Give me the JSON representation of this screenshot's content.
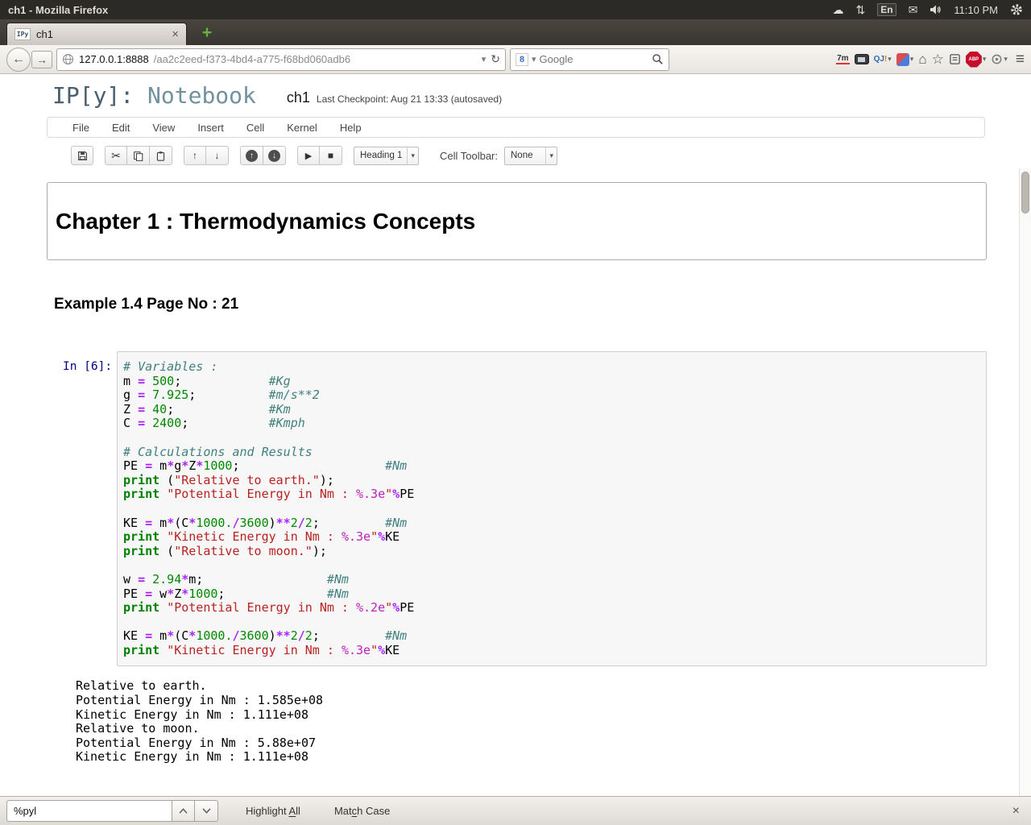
{
  "system_bar": {
    "window_title": "ch1 - Mozilla Firefox",
    "keyboard_indicator": "En",
    "clock": "11:10 PM"
  },
  "tab_bar": {
    "tab_title": "ch1",
    "tab_favicon": "IPy",
    "close_glyph": "×",
    "new_tab_glyph": "+"
  },
  "nav_bar": {
    "url_host": "127.0.0.1:8888",
    "url_path": "/aa2c2eed-f373-4bd4-a775-f68bd060adb6",
    "search_placeholder": "Google",
    "addon_7m": "7m",
    "addon_qj": "QJ",
    "addon_qj_bang": "!",
    "adblock_label": "ABP",
    "back_glyph": "←",
    "forward_glyph": "→",
    "reload_glyph": "↻",
    "dropdown_glyph": "▾",
    "home_glyph": "⌂",
    "star_glyph": "☆",
    "menu_glyph": "≡"
  },
  "notebook": {
    "logo_prefix": "IP[y]:",
    "logo_suffix": " Notebook",
    "title": "ch1",
    "checkpoint": "Last Checkpoint: Aug 21 13:33 (autosaved)",
    "menus": [
      "File",
      "Edit",
      "View",
      "Insert",
      "Cell",
      "Kernel",
      "Help"
    ],
    "toolbar": {
      "cell_type_value": "Heading 1",
      "cell_toolbar_label": "Cell Toolbar:",
      "cell_toolbar_value": "None",
      "cut_glyph": "✂",
      "up_glyph": "↑",
      "down_glyph": "↓",
      "run_glyph": "▶",
      "stop_glyph": "■"
    }
  },
  "cells": {
    "heading1": "Chapter 1 : Thermodynamics Concepts",
    "heading3": "Example 1.4 Page No : 21",
    "code_prompt": "In [6]:",
    "code_lines": [
      [
        {
          "t": "c",
          "s": "# Variables :"
        }
      ],
      [
        {
          "t": "p",
          "s": "m "
        },
        {
          "t": "o",
          "s": "="
        },
        {
          "t": "p",
          "s": " "
        },
        {
          "t": "n",
          "s": "500"
        },
        {
          "t": "p",
          "s": ";            "
        },
        {
          "t": "c",
          "s": "#Kg"
        }
      ],
      [
        {
          "t": "p",
          "s": "g "
        },
        {
          "t": "o",
          "s": "="
        },
        {
          "t": "p",
          "s": " "
        },
        {
          "t": "n",
          "s": "7.925"
        },
        {
          "t": "p",
          "s": ";          "
        },
        {
          "t": "c",
          "s": "#m/s**2"
        }
      ],
      [
        {
          "t": "p",
          "s": "Z "
        },
        {
          "t": "o",
          "s": "="
        },
        {
          "t": "p",
          "s": " "
        },
        {
          "t": "n",
          "s": "40"
        },
        {
          "t": "p",
          "s": ";             "
        },
        {
          "t": "c",
          "s": "#Km"
        }
      ],
      [
        {
          "t": "p",
          "s": "C "
        },
        {
          "t": "o",
          "s": "="
        },
        {
          "t": "p",
          "s": " "
        },
        {
          "t": "n",
          "s": "2400"
        },
        {
          "t": "p",
          "s": ";           "
        },
        {
          "t": "c",
          "s": "#Kmph"
        }
      ],
      [],
      [
        {
          "t": "c",
          "s": "# Calculations and Results"
        }
      ],
      [
        {
          "t": "p",
          "s": "PE "
        },
        {
          "t": "o",
          "s": "="
        },
        {
          "t": "p",
          "s": " m"
        },
        {
          "t": "o",
          "s": "*"
        },
        {
          "t": "p",
          "s": "g"
        },
        {
          "t": "o",
          "s": "*"
        },
        {
          "t": "p",
          "s": "Z"
        },
        {
          "t": "o",
          "s": "*"
        },
        {
          "t": "n",
          "s": "1000"
        },
        {
          "t": "p",
          "s": ";                    "
        },
        {
          "t": "c",
          "s": "#Nm"
        }
      ],
      [
        {
          "t": "k",
          "s": "print"
        },
        {
          "t": "p",
          "s": " ("
        },
        {
          "t": "s",
          "s": "\"Relative to earth.\""
        },
        {
          "t": "p",
          "s": ");"
        }
      ],
      [
        {
          "t": "k",
          "s": "print"
        },
        {
          "t": "p",
          "s": " "
        },
        {
          "t": "s",
          "s": "\"Potential Energy in Nm : "
        },
        {
          "t": "f",
          "s": "%.3e"
        },
        {
          "t": "s",
          "s": "\""
        },
        {
          "t": "o",
          "s": "%"
        },
        {
          "t": "p",
          "s": "PE"
        }
      ],
      [],
      [
        {
          "t": "p",
          "s": "KE "
        },
        {
          "t": "o",
          "s": "="
        },
        {
          "t": "p",
          "s": " m"
        },
        {
          "t": "o",
          "s": "*"
        },
        {
          "t": "p",
          "s": "(C"
        },
        {
          "t": "o",
          "s": "*"
        },
        {
          "t": "n",
          "s": "1000."
        },
        {
          "t": "o",
          "s": "/"
        },
        {
          "t": "n",
          "s": "3600"
        },
        {
          "t": "p",
          "s": ")"
        },
        {
          "t": "o",
          "s": "**"
        },
        {
          "t": "n",
          "s": "2"
        },
        {
          "t": "o",
          "s": "/"
        },
        {
          "t": "n",
          "s": "2"
        },
        {
          "t": "p",
          "s": ";         "
        },
        {
          "t": "c",
          "s": "#Nm"
        }
      ],
      [
        {
          "t": "k",
          "s": "print"
        },
        {
          "t": "p",
          "s": " "
        },
        {
          "t": "s",
          "s": "\"Kinetic Energy in Nm : "
        },
        {
          "t": "f",
          "s": "%.3e"
        },
        {
          "t": "s",
          "s": "\""
        },
        {
          "t": "o",
          "s": "%"
        },
        {
          "t": "p",
          "s": "KE"
        }
      ],
      [
        {
          "t": "k",
          "s": "print"
        },
        {
          "t": "p",
          "s": " ("
        },
        {
          "t": "s",
          "s": "\"Relative to moon.\""
        },
        {
          "t": "p",
          "s": ");"
        }
      ],
      [],
      [
        {
          "t": "p",
          "s": "w "
        },
        {
          "t": "o",
          "s": "="
        },
        {
          "t": "p",
          "s": " "
        },
        {
          "t": "n",
          "s": "2.94"
        },
        {
          "t": "o",
          "s": "*"
        },
        {
          "t": "p",
          "s": "m;                 "
        },
        {
          "t": "c",
          "s": "#Nm"
        }
      ],
      [
        {
          "t": "p",
          "s": "PE "
        },
        {
          "t": "o",
          "s": "="
        },
        {
          "t": "p",
          "s": " w"
        },
        {
          "t": "o",
          "s": "*"
        },
        {
          "t": "p",
          "s": "Z"
        },
        {
          "t": "o",
          "s": "*"
        },
        {
          "t": "n",
          "s": "1000"
        },
        {
          "t": "p",
          "s": ";              "
        },
        {
          "t": "c",
          "s": "#Nm"
        }
      ],
      [
        {
          "t": "k",
          "s": "print"
        },
        {
          "t": "p",
          "s": " "
        },
        {
          "t": "s",
          "s": "\"Potential Energy in Nm : "
        },
        {
          "t": "f",
          "s": "%.2e"
        },
        {
          "t": "s",
          "s": "\""
        },
        {
          "t": "o",
          "s": "%"
        },
        {
          "t": "p",
          "s": "PE"
        }
      ],
      [],
      [
        {
          "t": "p",
          "s": "KE "
        },
        {
          "t": "o",
          "s": "="
        },
        {
          "t": "p",
          "s": " m"
        },
        {
          "t": "o",
          "s": "*"
        },
        {
          "t": "p",
          "s": "(C"
        },
        {
          "t": "o",
          "s": "*"
        },
        {
          "t": "n",
          "s": "1000."
        },
        {
          "t": "o",
          "s": "/"
        },
        {
          "t": "n",
          "s": "3600"
        },
        {
          "t": "p",
          "s": ")"
        },
        {
          "t": "o",
          "s": "**"
        },
        {
          "t": "n",
          "s": "2"
        },
        {
          "t": "o",
          "s": "/"
        },
        {
          "t": "n",
          "s": "2"
        },
        {
          "t": "p",
          "s": ";         "
        },
        {
          "t": "c",
          "s": "#Nm"
        }
      ],
      [
        {
          "t": "k",
          "s": "print"
        },
        {
          "t": "p",
          "s": " "
        },
        {
          "t": "s",
          "s": "\"Kinetic Energy in Nm : "
        },
        {
          "t": "f",
          "s": "%.3e"
        },
        {
          "t": "s",
          "s": "\""
        },
        {
          "t": "o",
          "s": "%"
        },
        {
          "t": "p",
          "s": "KE"
        }
      ]
    ],
    "output_lines": [
      "Relative to earth.",
      "Potential Energy in Nm : 1.585e+08",
      "Kinetic Energy in Nm : 1.111e+08",
      "Relative to moon.",
      "Potential Energy in Nm : 5.88e+07",
      "Kinetic Energy in Nm : 1.111e+08"
    ]
  },
  "syntax_colors": {
    "comment": "#408080",
    "keyword": "#008000",
    "number": "#008800",
    "operator": "#AA22FF",
    "string": "#BA2121",
    "format": "#BB22BB",
    "prompt": "#000080"
  },
  "find_bar": {
    "query": "%pyl",
    "highlight_all": {
      "pre": "Highlight ",
      "key": "A",
      "post": "ll"
    },
    "match_case": {
      "pre": "Mat",
      "key": "c",
      "post": "h Case"
    },
    "close_glyph": "×"
  }
}
